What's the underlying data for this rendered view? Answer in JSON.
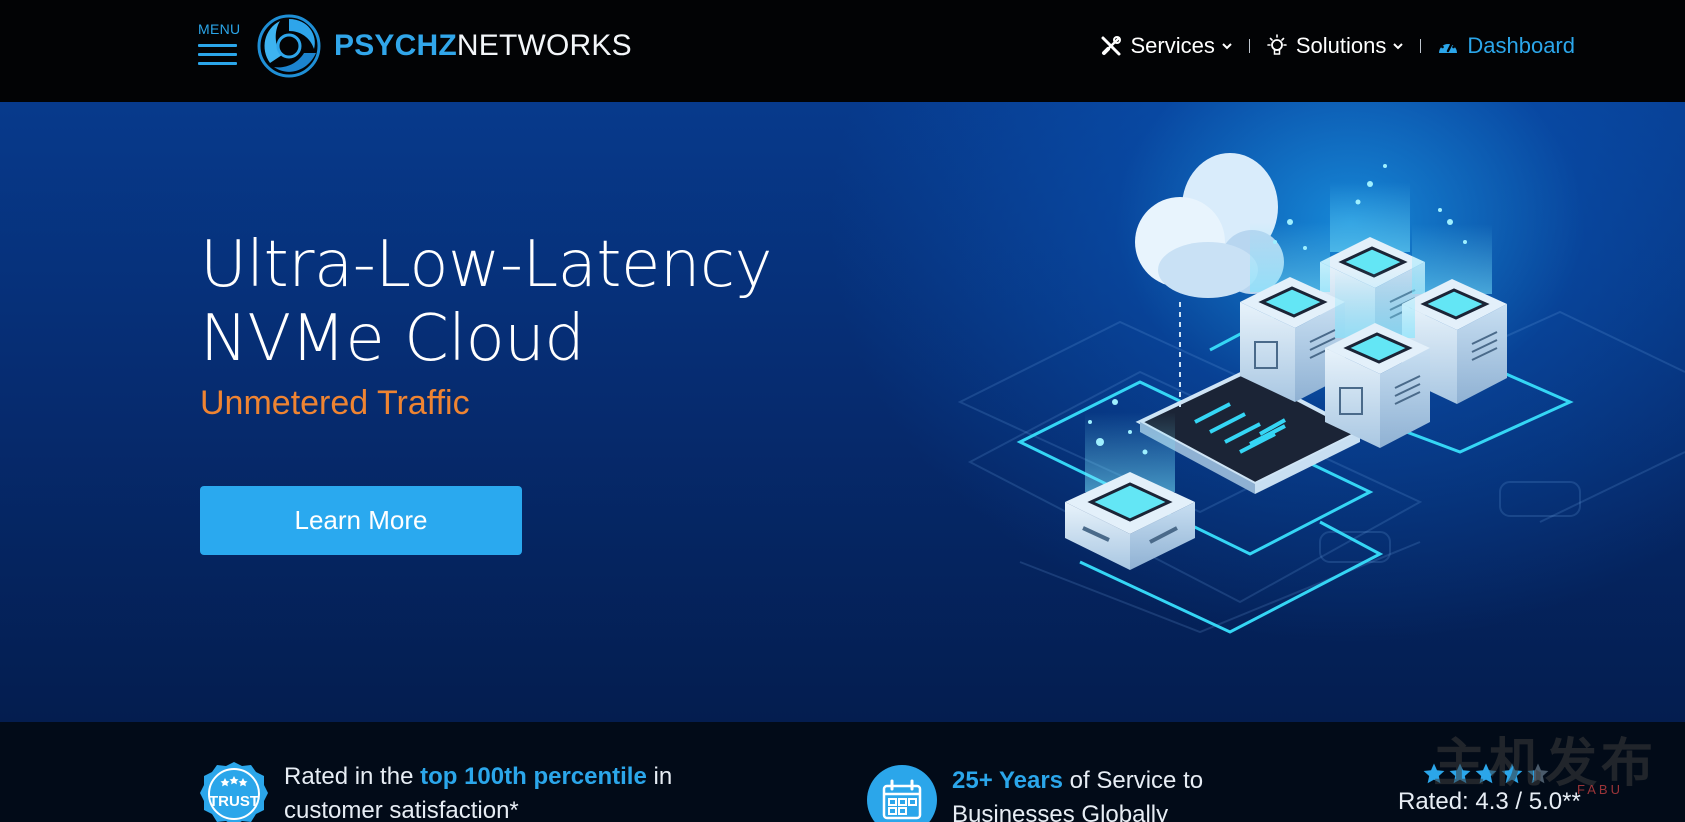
{
  "header": {
    "menu_label": "MENU",
    "logo": {
      "part1": "PSYCHZ",
      "part2": "NETWORKS"
    },
    "nav": [
      {
        "label": "Services",
        "icon": "tools-icon",
        "dropdown": true
      },
      {
        "label": "Solutions",
        "icon": "lightbulb-icon",
        "dropdown": true
      },
      {
        "label": "Dashboard",
        "icon": "dashboard-gauge-icon",
        "dropdown": false
      }
    ]
  },
  "hero": {
    "title_line1": "Ultra-Low-Latency",
    "title_line2": "NVMe Cloud",
    "subtitle": "Unmetered Traffic",
    "cta_label": "Learn More",
    "illustration": "isometric-cloud-servers-illustration"
  },
  "features": {
    "trust": {
      "icon": "trust-badge-icon",
      "badge_text": "TRUST",
      "prefix": "Rated in the ",
      "highlight": "top 100th percentile",
      "suffix": " in",
      "line2": "customer satisfaction*"
    },
    "years": {
      "icon": "calendar-icon",
      "highlight": "25+ Years",
      "suffix": " of Service to",
      "line2": "Businesses Globally"
    },
    "rating": {
      "stars_value": 4.3,
      "stars_max": 5,
      "text": "Rated: 4.3 / 5.0**"
    }
  },
  "watermark": {
    "main": "主机发布",
    "sub": "FABU"
  },
  "colors": {
    "accent": "#2ba6ea",
    "subtitle_orange": "#ef8432",
    "header_bg": "#020305",
    "hero_top": "#073a8c",
    "strip_bg": "#020b18"
  }
}
